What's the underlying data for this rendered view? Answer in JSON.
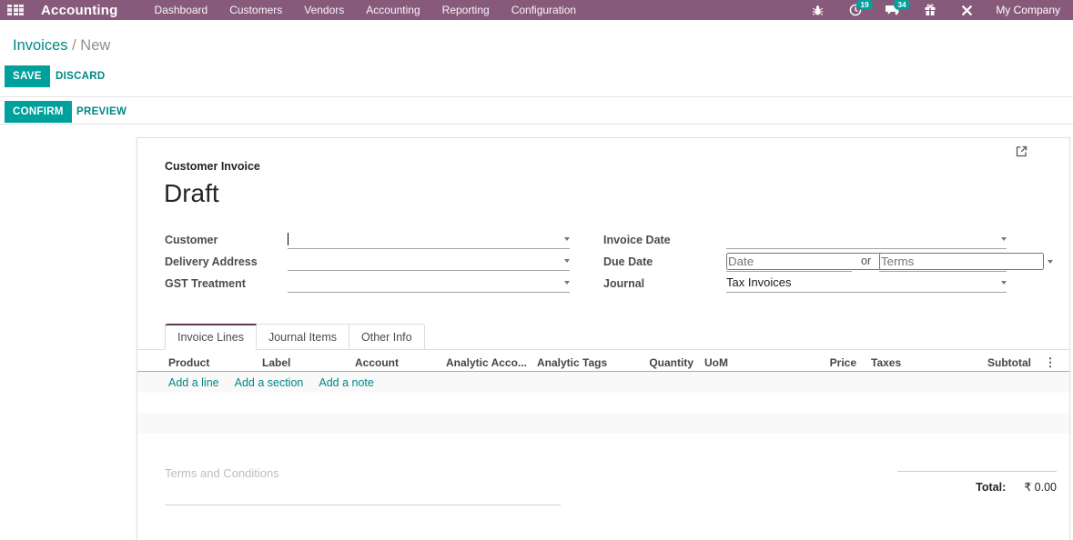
{
  "topbar": {
    "brand": "Accounting",
    "menu": [
      "Dashboard",
      "Customers",
      "Vendors",
      "Accounting",
      "Reporting",
      "Configuration"
    ],
    "activity_count": "19",
    "message_count": "34",
    "company": "My Company"
  },
  "breadcrumb": {
    "parent": "Invoices",
    "separator": "/",
    "current": "New"
  },
  "actions": {
    "save": "SAVE",
    "discard": "DISCARD",
    "confirm": "CONFIRM",
    "preview": "PREVIEW"
  },
  "sheet": {
    "doc_type": "Customer Invoice",
    "state": "Draft",
    "fields": {
      "customer_label": "Customer",
      "delivery_address_label": "Delivery Address",
      "gst_treatment_label": "GST Treatment",
      "invoice_date_label": "Invoice Date",
      "due_date_label": "Due Date",
      "due_date_placeholder": "Date",
      "or_label": "or",
      "terms_placeholder": "Terms",
      "journal_label": "Journal",
      "journal_value": "Tax Invoices"
    },
    "tabs": [
      "Invoice Lines",
      "Journal Items",
      "Other Info"
    ],
    "columns": [
      "Product",
      "Label",
      "Account",
      "Analytic Acco...",
      "Analytic Tags",
      "Quantity",
      "UoM",
      "Price",
      "Taxes",
      "Subtotal"
    ],
    "dots": "⋮",
    "list_actions": [
      "Add a line",
      "Add a section",
      "Add a note"
    ],
    "terms_placeholder": "Terms and Conditions",
    "total_label": "Total:",
    "total_value": "₹ 0.00"
  },
  "colors": {
    "topbar_bg": "#875A7B",
    "accent": "#00A09D",
    "link": "#008784",
    "badge": "#00A09D",
    "tab_active_border": "#5d3954"
  }
}
